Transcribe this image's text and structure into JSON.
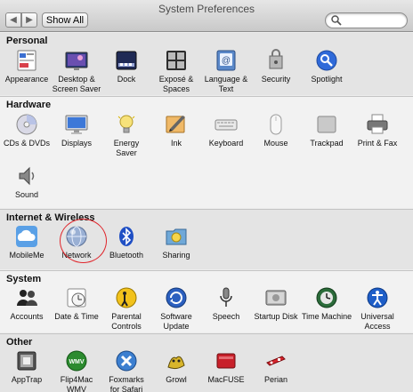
{
  "window": {
    "title": "System Preferences",
    "back_glyph": "◀",
    "forward_glyph": "▶"
  },
  "toolbar": {
    "show_all_label": "Show All",
    "search": {
      "value": "",
      "placeholder": ""
    }
  },
  "colors": {
    "highlight_ring": "#e0252b",
    "section_alt": "#e4e4e4",
    "section_base": "#f2f2f2"
  },
  "sections": {
    "personal": {
      "title": "Personal",
      "items": [
        {
          "label": "Appearance",
          "icon": "appearance-icon"
        },
        {
          "label": "Desktop &\nScreen Saver",
          "icon": "desktop-screensaver-icon"
        },
        {
          "label": "Dock",
          "icon": "dock-icon"
        },
        {
          "label": "Exposé &\nSpaces",
          "icon": "expose-spaces-icon"
        },
        {
          "label": "Language &\nText",
          "icon": "language-text-icon"
        },
        {
          "label": "Security",
          "icon": "security-icon"
        },
        {
          "label": "Spotlight",
          "icon": "spotlight-icon"
        }
      ]
    },
    "hardware": {
      "title": "Hardware",
      "items": [
        {
          "label": "CDs & DVDs",
          "icon": "cd-dvd-icon"
        },
        {
          "label": "Displays",
          "icon": "displays-icon"
        },
        {
          "label": "Energy\nSaver",
          "icon": "energy-saver-icon"
        },
        {
          "label": "Ink",
          "icon": "ink-icon"
        },
        {
          "label": "Keyboard",
          "icon": "keyboard-icon"
        },
        {
          "label": "Mouse",
          "icon": "mouse-icon"
        },
        {
          "label": "Trackpad",
          "icon": "trackpad-icon"
        },
        {
          "label": "Print & Fax",
          "icon": "printer-icon"
        },
        {
          "label": "Sound",
          "icon": "sound-icon"
        }
      ]
    },
    "internet": {
      "title": "Internet & Wireless",
      "items": [
        {
          "label": "MobileMe",
          "icon": "mobileme-icon"
        },
        {
          "label": "Network",
          "icon": "network-icon",
          "highlighted": true
        },
        {
          "label": "Bluetooth",
          "icon": "bluetooth-icon"
        },
        {
          "label": "Sharing",
          "icon": "sharing-icon"
        }
      ]
    },
    "system": {
      "title": "System",
      "items": [
        {
          "label": "Accounts",
          "icon": "accounts-icon"
        },
        {
          "label": "Date & Time",
          "icon": "date-time-icon"
        },
        {
          "label": "Parental\nControls",
          "icon": "parental-controls-icon"
        },
        {
          "label": "Software\nUpdate",
          "icon": "software-update-icon"
        },
        {
          "label": "Speech",
          "icon": "speech-icon"
        },
        {
          "label": "Startup Disk",
          "icon": "startup-disk-icon"
        },
        {
          "label": "Time Machine",
          "icon": "time-machine-icon"
        },
        {
          "label": "Universal\nAccess",
          "icon": "universal-access-icon"
        }
      ]
    },
    "other": {
      "title": "Other",
      "items": [
        {
          "label": "AppTrap",
          "icon": "apptrap-icon"
        },
        {
          "label": "Flip4Mac\nWMV",
          "icon": "flip4mac-icon"
        },
        {
          "label": "Foxmarks\nfor Safari",
          "icon": "foxmarks-icon"
        },
        {
          "label": "Growl",
          "icon": "growl-icon"
        },
        {
          "label": "MacFUSE",
          "icon": "macfuse-icon"
        },
        {
          "label": "Perian",
          "icon": "perian-icon"
        }
      ]
    }
  }
}
